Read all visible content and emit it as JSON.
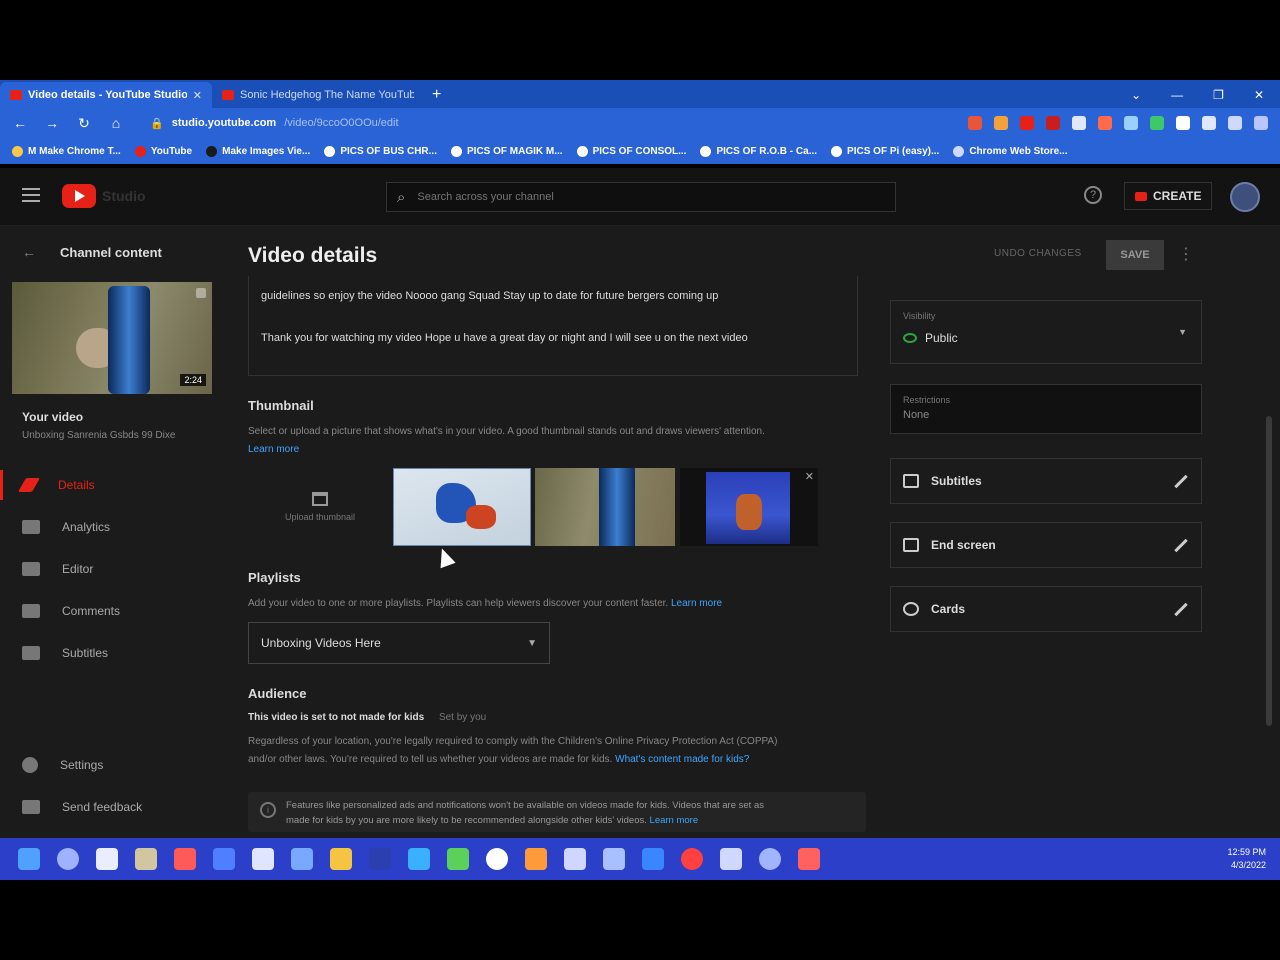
{
  "browser": {
    "tabs": [
      {
        "label": "Video details - YouTube Studio",
        "active": true
      },
      {
        "label": "Sonic Hedgehog The Name YouTube",
        "active": false
      }
    ],
    "new_tab": "+",
    "url_host": "studio.youtube.com",
    "url_path": "/video/9ccoO0OOu/edit",
    "bookmarks": [
      "M Make Chrome T...",
      "YouTube",
      "Make Images Vie...",
      "PICS OF BUS CHR...",
      "PICS OF MAGIK M...",
      "PICS OF CONSOL...",
      "PICS OF R.O.B - Ca...",
      "PICS OF Pi (easy)...",
      "Chrome Web Store..."
    ]
  },
  "header": {
    "brand": "Studio",
    "search_placeholder": "Search across your channel",
    "create_label": "CREATE"
  },
  "sidebar": {
    "back_label": "Channel content",
    "thumb_duration": "2:24",
    "your_video_label": "Your video",
    "video_subtitle": "Unboxing Sanrenia Gsbds 99 Dixe",
    "items": [
      {
        "label": "Details",
        "active": true
      },
      {
        "label": "Analytics",
        "active": false
      },
      {
        "label": "Editor",
        "active": false
      },
      {
        "label": "Comments",
        "active": false
      },
      {
        "label": "Subtitles",
        "active": false
      }
    ],
    "bottom_items": [
      {
        "label": "Settings"
      },
      {
        "label": "Send feedback"
      }
    ]
  },
  "main": {
    "title": "Video details",
    "undo_label": "UNDO CHANGES",
    "save_label": "SAVE",
    "description_lines": [
      "guidelines so enjoy the video Noooo gang Squad Stay up to date for future bergers coming up",
      "Thank you for watching my video Hope u have a great day or night and I will see u on the next video"
    ],
    "thumbnail": {
      "title": "Thumbnail",
      "desc": "Select or upload a picture that shows what's in your video. A good thumbnail stands out and draws viewers' attention.",
      "learn_more": "Learn more",
      "upload_label": "Upload thumbnail"
    },
    "playlists": {
      "title": "Playlists",
      "desc": "Add your video to one or more playlists. Playlists can help viewers discover your content faster.",
      "learn_more": "Learn more",
      "selected": "Unboxing Videos Here"
    },
    "audience": {
      "title": "Audience",
      "status": "This video is set to not made for kids",
      "set_by": "Set by you",
      "desc1": "Regardless of your location, you're legally required to comply with the Children's Online Privacy Protection Act (COPPA)",
      "desc2": "and/or other laws. You're required to tell us whether your videos are made for kids.",
      "link": "What's content made for kids?",
      "info1": "Features like personalized ads and notifications won't be available on videos made for kids. Videos that are set as",
      "info2": "made for kids by you are more likely to be recommended alongside other kids' videos.",
      "info_link": "Learn more"
    },
    "visibility": {
      "label": "Visibility",
      "value": "Public"
    },
    "restrictions": {
      "label": "Restrictions",
      "value": "None"
    },
    "rows": [
      {
        "label": "Subtitles",
        "icon": "subtitles-icon"
      },
      {
        "label": "End screen",
        "icon": "end-screen-icon"
      },
      {
        "label": "Cards",
        "icon": "info-icon"
      }
    ]
  },
  "taskbar": {
    "time": "12:59 PM",
    "date": "4/3/2022"
  },
  "colors": {
    "accent": "#e62117",
    "link": "#3ea6ff",
    "public_green": "#2ba640",
    "taskbar": "#2c3fc8",
    "browser_chrome": "#2a63d6"
  }
}
